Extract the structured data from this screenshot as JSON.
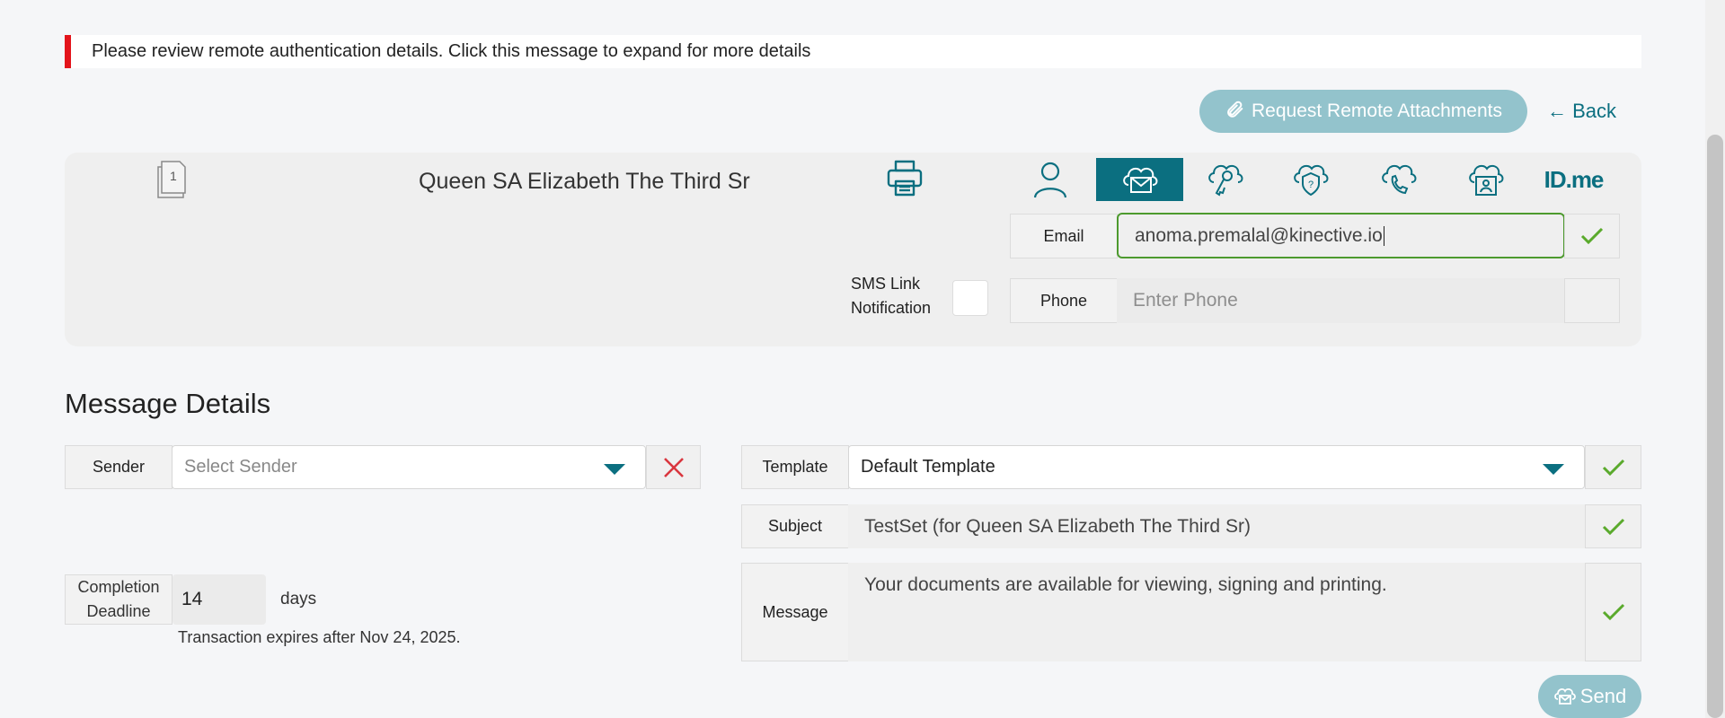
{
  "alert": {
    "message": "Please review remote authentication details. Click this message to expand for more details"
  },
  "toolbar": {
    "request_remote_label": "Request Remote Attachments",
    "back_label": "← Back"
  },
  "recipient": {
    "doc_number": "1",
    "name": "Queen SA Elizabeth The Third Sr",
    "idme_label": "ID.me",
    "email_label": "Email",
    "email_value": "anoma.premalal@kinective.io",
    "phone_label": "Phone",
    "phone_placeholder": "Enter Phone",
    "sms_label_line1": "SMS Link",
    "sms_label_line2": "Notification"
  },
  "message_details": {
    "title": "Message Details",
    "sender_label": "Sender",
    "sender_placeholder": "Select Sender",
    "template_label": "Template",
    "template_value": "Default Template",
    "subject_label": "Subject",
    "subject_value": "TestSet (for Queen SA Elizabeth The Third Sr)",
    "message_label": "Message",
    "message_value": "Your documents are available for viewing, signing and printing.",
    "completion_label_line1": "Completion",
    "completion_label_line2": "Deadline",
    "deadline_value": "14",
    "days_label": "days",
    "expiry_note": "Transaction expires after Nov 24, 2025.",
    "send_label": "Send"
  },
  "colors": {
    "accent": "#0b6f80",
    "accent_light": "#93c3cc",
    "alert": "#e3141b",
    "check": "#5aaa2c",
    "error": "#d9363e"
  }
}
